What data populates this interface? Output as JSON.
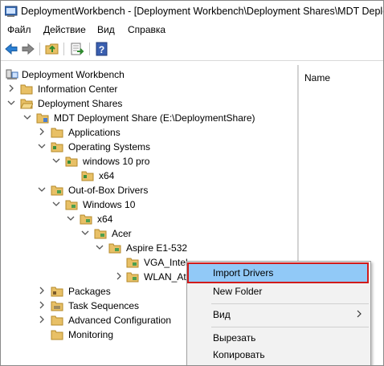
{
  "window": {
    "title": "DeploymentWorkbench - [Deployment Workbench\\Deployment Shares\\MDT Deploy",
    "icon": "mdt-app-icon"
  },
  "menu": {
    "file": "Файл",
    "action": "Действие",
    "view": "Вид",
    "help": "Справка"
  },
  "toolbar": {
    "icons": [
      "back-arrow-icon",
      "forward-arrow-icon",
      "up-folder-icon",
      "export-list-icon",
      "help-book-icon"
    ]
  },
  "right_pane": {
    "column_name": "Name"
  },
  "tree": {
    "root": "Deployment Workbench",
    "information_center": "Information Center",
    "deployment_shares": "Deployment Shares",
    "mdt_share": "MDT Deployment Share (E:\\DeploymentShare)",
    "applications": "Applications",
    "operating_systems": "Operating Systems",
    "os_windows10pro": "windows 10 pro",
    "os_x64": "x64",
    "oob_drivers": "Out-of-Box Drivers",
    "drv_windows10": "Windows 10",
    "drv_x64": "x64",
    "drv_acer": "Acer",
    "drv_aspire": "Aspire E1-532",
    "drv_vga": "VGA_Intel",
    "drv_wlan": "WLAN_At",
    "packages": "Packages",
    "task_sequences": "Task Sequences",
    "advanced_configuration": "Advanced Configuration",
    "monitoring": "Monitoring"
  },
  "context_menu": {
    "import_drivers": "Import Drivers",
    "new_folder": "New Folder",
    "view": "Вид",
    "cut": "Вырезать",
    "copy": "Копировать"
  },
  "colors": {
    "folder": "#e8c066",
    "highlight": "#91c9f7",
    "highlight_border": "#d11b1b",
    "toolbar_arrow": "#2a7fd4"
  }
}
